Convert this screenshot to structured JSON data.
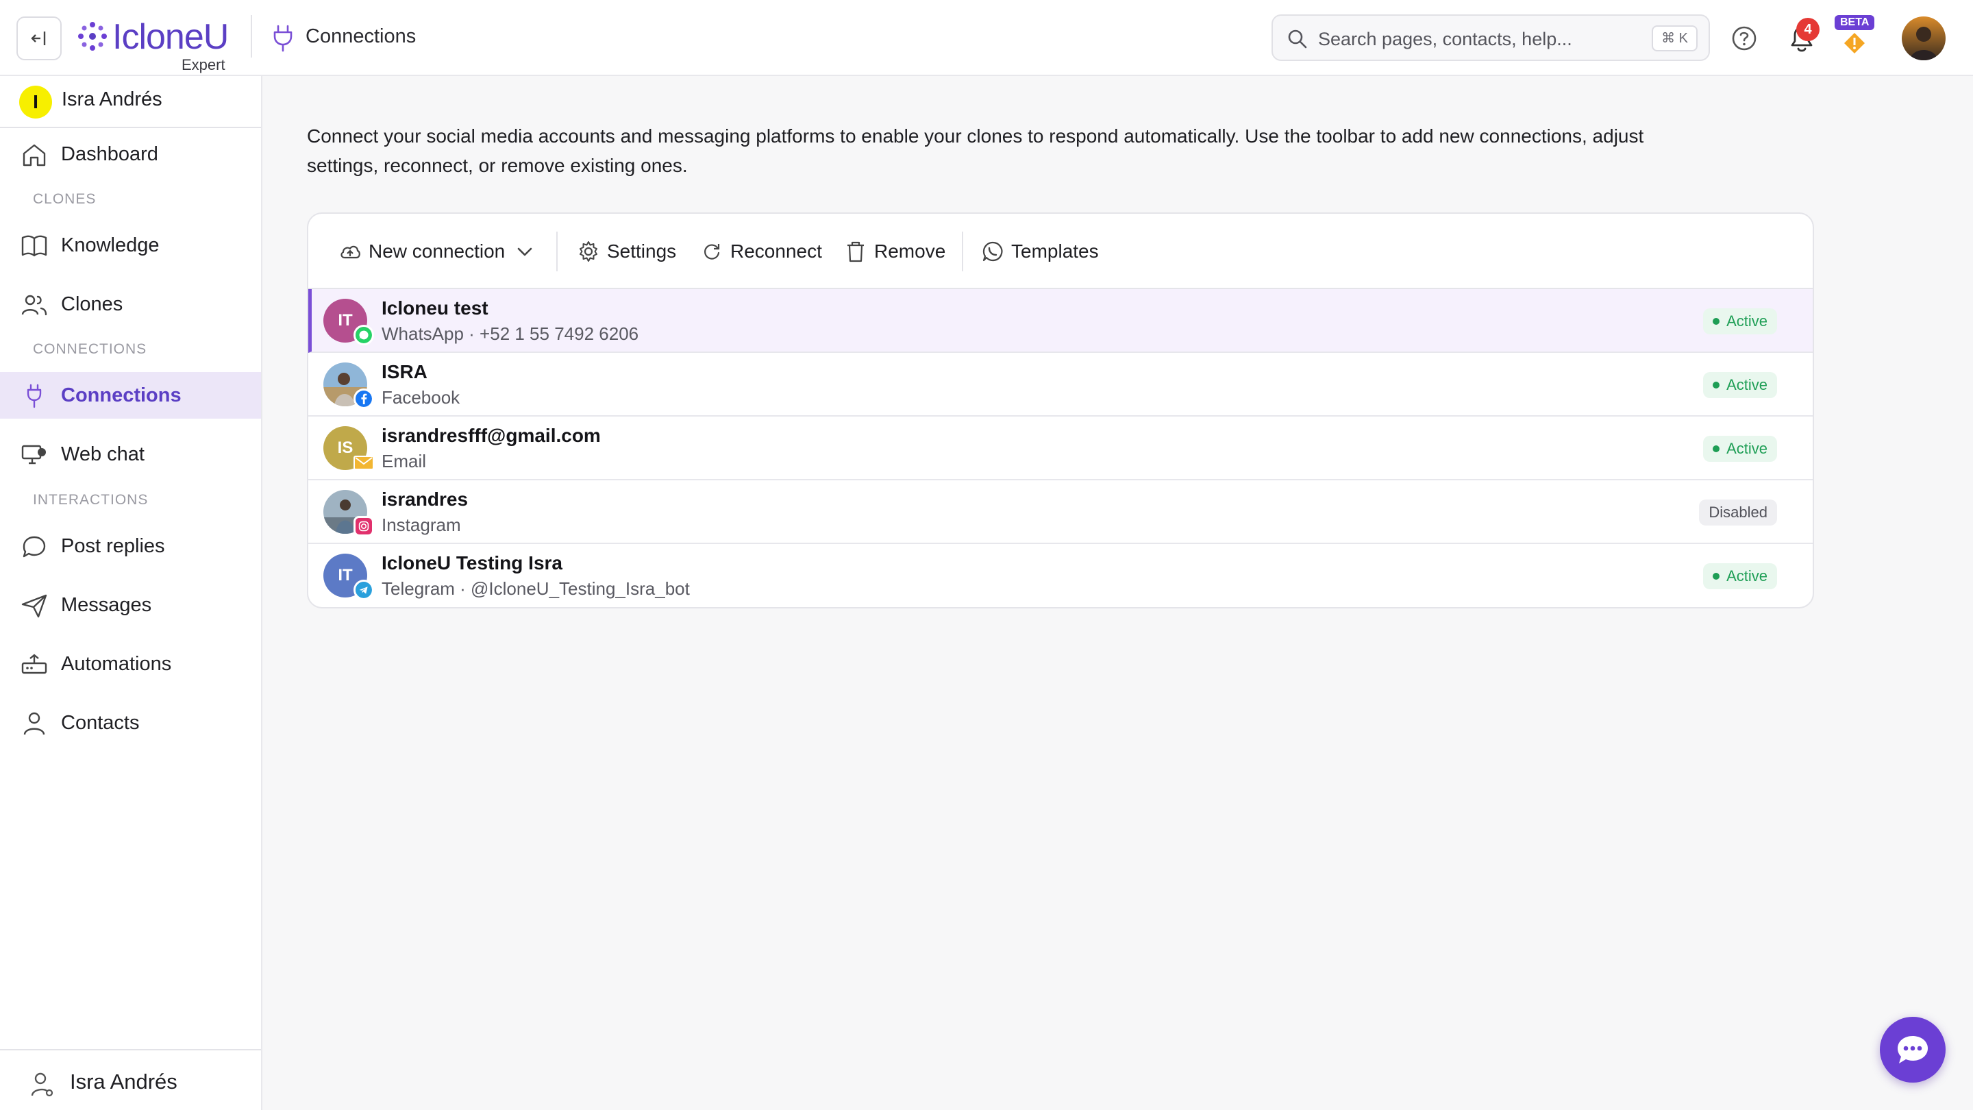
{
  "header": {
    "brand_name": "IcloneU",
    "brand_sub": "Expert",
    "page_title": "Connections",
    "search_placeholder": "Search pages, contacts, help...",
    "search_shortcut": "⌘ K",
    "notification_count": "4",
    "beta_label": "BETA"
  },
  "sidebar": {
    "user_initial": "I",
    "user_name": "Isra Andrés",
    "items": [
      {
        "label": "Dashboard",
        "icon": "home-icon"
      },
      {
        "label": "Knowledge",
        "icon": "book-icon"
      },
      {
        "label": "Clones",
        "icon": "users-icon"
      },
      {
        "label": "Connections",
        "icon": "plug-icon"
      },
      {
        "label": "Web chat",
        "icon": "monitor-chat-icon"
      },
      {
        "label": "Post replies",
        "icon": "speech-bubble-icon"
      },
      {
        "label": "Messages",
        "icon": "paper-plane-icon"
      },
      {
        "label": "Automations",
        "icon": "router-icon"
      },
      {
        "label": "Contacts",
        "icon": "person-icon"
      }
    ],
    "sections": [
      "CLONES",
      "CONNECTIONS",
      "INTERACTIONS"
    ],
    "bottom_user_name": "Isra Andrés"
  },
  "main": {
    "intro": "Connect your social media accounts and messaging platforms to enable your clones to respond automatically. Use the toolbar to add new connections, adjust settings, reconnect, or remove existing ones.",
    "toolbar": {
      "new_connection": "New connection",
      "settings": "Settings",
      "reconnect": "Reconnect",
      "remove": "Remove",
      "templates": "Templates"
    },
    "connections": [
      {
        "title": "Icloneu test",
        "subtitle": "WhatsApp · +52 1 55 7492 6206",
        "initials": "IT",
        "status": "Active",
        "platform": "whatsapp"
      },
      {
        "title": "ISRA",
        "subtitle": "Facebook",
        "initials": "",
        "status": "Active",
        "platform": "facebook"
      },
      {
        "title": "israndresfff@gmail.com",
        "subtitle": "Email",
        "initials": "IS",
        "status": "Active",
        "platform": "email"
      },
      {
        "title": "israndres",
        "subtitle": "Instagram",
        "initials": "",
        "status": "Disabled",
        "platform": "instagram"
      },
      {
        "title": "IcloneU Testing Isra",
        "subtitle": "Telegram · @IcloneU_Testing_Isra_bot",
        "initials": "IT",
        "status": "Active",
        "platform": "telegram"
      }
    ]
  },
  "colors": {
    "accent": "#5b3fc4",
    "active_status": "#1e9e55",
    "selected_row": "#f6f1fd",
    "whatsapp": "#25d366",
    "facebook": "#1877f2",
    "email": "#f2b632",
    "instagram": "#e1306c",
    "telegram": "#2aa0dc"
  }
}
